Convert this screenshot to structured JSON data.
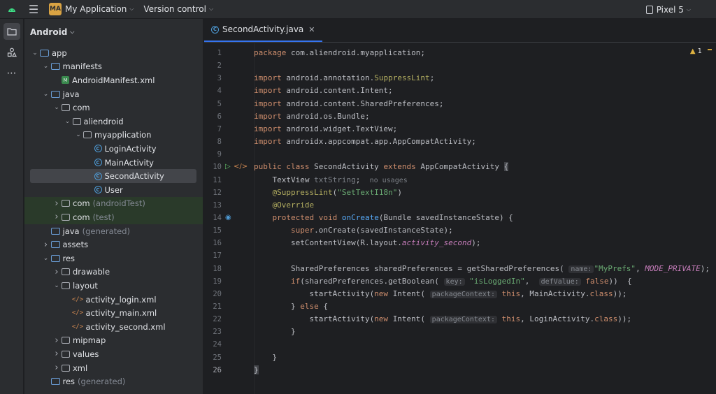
{
  "topbar": {
    "project_badge": "MA",
    "project_name": "My Application",
    "vcs_label": "Version control",
    "device": "Pixel 5"
  },
  "project_panel": {
    "title": "Android"
  },
  "tree": [
    {
      "label": "app",
      "dim": "",
      "icon": "module-folder-icon",
      "indent": 0,
      "arrow": "down"
    },
    {
      "label": "manifests",
      "dim": "",
      "icon": "folder-icon",
      "indent": 1,
      "arrow": "down"
    },
    {
      "label": "AndroidManifest.xml",
      "dim": "",
      "icon": "manifest-icon",
      "indent": 2,
      "arrow": ""
    },
    {
      "label": "java",
      "dim": "",
      "icon": "folder-icon",
      "indent": 1,
      "arrow": "down"
    },
    {
      "label": "com",
      "dim": "",
      "icon": "package-icon",
      "indent": 2,
      "arrow": "down"
    },
    {
      "label": "aliendroid",
      "dim": "",
      "icon": "package-icon",
      "indent": 3,
      "arrow": "down"
    },
    {
      "label": "myapplication",
      "dim": "",
      "icon": "package-icon",
      "indent": 4,
      "arrow": "down"
    },
    {
      "label": "LoginActivity",
      "dim": "",
      "icon": "class-icon",
      "indent": 5,
      "arrow": ""
    },
    {
      "label": "MainActivity",
      "dim": "",
      "icon": "class-icon",
      "indent": 5,
      "arrow": ""
    },
    {
      "label": "SecondActivity",
      "dim": "",
      "icon": "class-icon",
      "indent": 5,
      "arrow": "",
      "selected": true
    },
    {
      "label": "User",
      "dim": "",
      "icon": "class-icon",
      "indent": 5,
      "arrow": ""
    },
    {
      "label": "com",
      "dim": "(androidTest)",
      "icon": "package-icon",
      "indent": 2,
      "arrow": "right",
      "test": true
    },
    {
      "label": "com",
      "dim": "(test)",
      "icon": "package-icon",
      "indent": 2,
      "arrow": "right",
      "test": true
    },
    {
      "label": "java",
      "dim": "(generated)",
      "icon": "folder-icon",
      "indent": 1,
      "arrow": ""
    },
    {
      "label": "assets",
      "dim": "",
      "icon": "folder-icon",
      "indent": 1,
      "arrow": "right"
    },
    {
      "label": "res",
      "dim": "",
      "icon": "folder-icon",
      "indent": 1,
      "arrow": "down"
    },
    {
      "label": "drawable",
      "dim": "",
      "icon": "package-icon",
      "indent": 2,
      "arrow": "right"
    },
    {
      "label": "layout",
      "dim": "",
      "icon": "package-icon",
      "indent": 2,
      "arrow": "down"
    },
    {
      "label": "activity_login.xml",
      "dim": "",
      "icon": "xml-icon",
      "indent": 3,
      "arrow": ""
    },
    {
      "label": "activity_main.xml",
      "dim": "",
      "icon": "xml-icon",
      "indent": 3,
      "arrow": ""
    },
    {
      "label": "activity_second.xml",
      "dim": "",
      "icon": "xml-icon",
      "indent": 3,
      "arrow": ""
    },
    {
      "label": "mipmap",
      "dim": "",
      "icon": "package-icon",
      "indent": 2,
      "arrow": "right"
    },
    {
      "label": "values",
      "dim": "",
      "icon": "package-icon",
      "indent": 2,
      "arrow": "right"
    },
    {
      "label": "xml",
      "dim": "",
      "icon": "package-icon",
      "indent": 2,
      "arrow": "right"
    },
    {
      "label": "res",
      "dim": "(generated)",
      "icon": "folder-icon",
      "indent": 1,
      "arrow": ""
    }
  ],
  "editor": {
    "tab_label": "SecondActivity.java",
    "warning_count": "1",
    "current_line": 26,
    "lines": [
      {
        "n": 1,
        "t": [
          [
            "kw",
            "package "
          ],
          [
            "",
            "com.aliendroid.myapplication;"
          ]
        ]
      },
      {
        "n": 2,
        "t": []
      },
      {
        "n": 3,
        "t": [
          [
            "kw",
            "import "
          ],
          [
            "",
            "android.annotation."
          ],
          [
            "ann",
            "SuppressLint"
          ],
          [
            "",
            ";"
          ]
        ]
      },
      {
        "n": 4,
        "t": [
          [
            "kw",
            "import "
          ],
          [
            "",
            "android.content.Intent;"
          ]
        ]
      },
      {
        "n": 5,
        "t": [
          [
            "kw",
            "import "
          ],
          [
            "",
            "android.content.SharedPreferences;"
          ]
        ]
      },
      {
        "n": 6,
        "t": [
          [
            "kw",
            "import "
          ],
          [
            "",
            "android.os.Bundle;"
          ]
        ]
      },
      {
        "n": 7,
        "t": [
          [
            "kw",
            "import "
          ],
          [
            "",
            "android.widget.TextView;"
          ]
        ]
      },
      {
        "n": 8,
        "t": [
          [
            "kw",
            "import "
          ],
          [
            "",
            "androidx.appcompat.app.AppCompatActivity;"
          ]
        ]
      },
      {
        "n": 9,
        "t": []
      },
      {
        "n": 10,
        "t": [
          [
            "kw",
            "public class "
          ],
          [
            "",
            "SecondActivity "
          ],
          [
            "kw",
            "extends "
          ],
          [
            "",
            "AppCompatActivity "
          ],
          [
            "cursor",
            "{"
          ]
        ]
      },
      {
        "n": 11,
        "t": [
          [
            "",
            "    TextView "
          ],
          [
            "muted",
            "txtString"
          ],
          [
            "",
            ";  "
          ],
          [
            "hintplain",
            "no usages"
          ]
        ]
      },
      {
        "n": 12,
        "t": [
          [
            "ann",
            "    @SuppressLint"
          ],
          [
            "",
            "("
          ],
          [
            "str",
            "\"SetTextI18n\""
          ],
          [
            "",
            ")"
          ]
        ]
      },
      {
        "n": 13,
        "t": [
          [
            "ann",
            "    @Override"
          ]
        ]
      },
      {
        "n": 14,
        "t": [
          [
            "kw",
            "    protected void "
          ],
          [
            "fn",
            "onCreate"
          ],
          [
            "",
            "(Bundle savedInstanceState) {"
          ]
        ]
      },
      {
        "n": 15,
        "t": [
          [
            "kw",
            "        super"
          ],
          [
            "",
            ".onCreate(savedInstanceState);"
          ]
        ]
      },
      {
        "n": 16,
        "t": [
          [
            "",
            "        setContentView(R.layout."
          ],
          [
            "fld",
            "activity_second"
          ],
          [
            "",
            ");"
          ]
        ]
      },
      {
        "n": 17,
        "t": []
      },
      {
        "n": 18,
        "t": [
          [
            "",
            "        SharedPreferences sharedPreferences = getSharedPreferences( "
          ],
          [
            "hint",
            "name:"
          ],
          [
            "str",
            "\"MyPrefs\""
          ],
          [
            "",
            ", "
          ],
          [
            "fld",
            "MODE_PRIVATE"
          ],
          [
            "",
            ");"
          ]
        ]
      },
      {
        "n": 19,
        "t": [
          [
            "kw",
            "        if"
          ],
          [
            "",
            "(sharedPreferences.getBoolean( "
          ],
          [
            "hint",
            "key:"
          ],
          [
            "str",
            " \"isLoggedIn\""
          ],
          [
            "",
            ",  "
          ],
          [
            "hint",
            "defValue:"
          ],
          [
            "kw",
            " false"
          ],
          [
            "",
            "))  {"
          ]
        ]
      },
      {
        "n": 20,
        "t": [
          [
            "",
            "            startActivity("
          ],
          [
            "kw",
            "new "
          ],
          [
            "",
            "Intent( "
          ],
          [
            "hint",
            "packageContext:"
          ],
          [
            "kw",
            " this"
          ],
          [
            "",
            ", MainActivity."
          ],
          [
            "kw",
            "class"
          ],
          [
            "",
            "));"
          ]
        ]
      },
      {
        "n": 21,
        "t": [
          [
            "",
            "        } "
          ],
          [
            "kw",
            "else "
          ],
          [
            "",
            "{"
          ]
        ]
      },
      {
        "n": 22,
        "t": [
          [
            "",
            "            startActivity("
          ],
          [
            "kw",
            "new "
          ],
          [
            "",
            "Intent( "
          ],
          [
            "hint",
            "packageContext:"
          ],
          [
            "kw",
            " this"
          ],
          [
            "",
            ", LoginActivity."
          ],
          [
            "kw",
            "class"
          ],
          [
            "",
            "));"
          ]
        ]
      },
      {
        "n": 23,
        "t": [
          [
            "",
            "        }"
          ]
        ]
      },
      {
        "n": 24,
        "t": []
      },
      {
        "n": 25,
        "t": [
          [
            "",
            "    }"
          ]
        ]
      },
      {
        "n": 26,
        "t": [
          [
            "cursor",
            "}"
          ]
        ]
      }
    ]
  }
}
